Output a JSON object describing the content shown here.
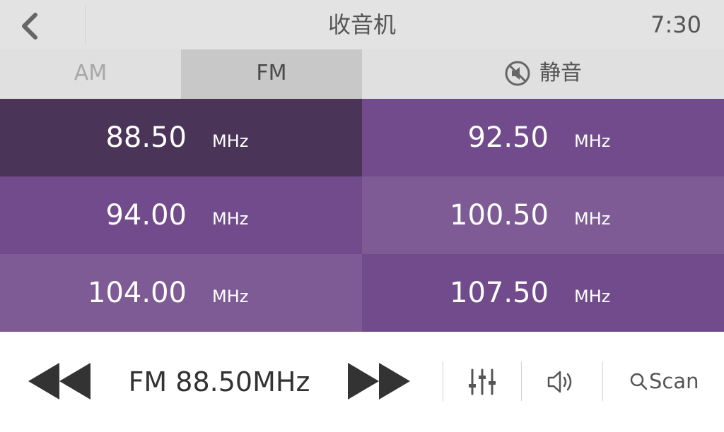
{
  "header": {
    "title": "收音机",
    "time": "7:30",
    "back_icon": "chevron-left-icon"
  },
  "tabs": [
    {
      "label": "AM",
      "active": false
    },
    {
      "label": "FM",
      "active": true
    }
  ],
  "mute": {
    "label": "静音",
    "icon": "mute-icon"
  },
  "presets": [
    {
      "frequency": "88.50",
      "unit": "MHz",
      "selected": true,
      "color": "#4a3558"
    },
    {
      "frequency": "92.50",
      "unit": "MHz",
      "selected": false,
      "color": "#714b8b"
    },
    {
      "frequency": "94.00",
      "unit": "MHz",
      "selected": false,
      "color": "#714b8b"
    },
    {
      "frequency": "100.50",
      "unit": "MHz",
      "selected": false,
      "color": "#7e5b95"
    },
    {
      "frequency": "104.00",
      "unit": "MHz",
      "selected": false,
      "color": "#7e5b95"
    },
    {
      "frequency": "107.50",
      "unit": "MHz",
      "selected": false,
      "color": "#714b8b"
    }
  ],
  "player": {
    "now_playing": "FM 88.50MHz",
    "prev_icon": "rewind-icon",
    "next_icon": "fast-forward-icon",
    "equalizer_icon": "equalizer-icon",
    "volume_icon": "volume-icon",
    "scan_label": "Scan",
    "scan_icon": "search-icon"
  },
  "colors": {
    "header_bg": "#e3e3e3",
    "tab_active_bg": "#c8c8c8",
    "accent_dark": "#4a3558",
    "accent": "#714b8b",
    "accent_light": "#7e5b95"
  }
}
